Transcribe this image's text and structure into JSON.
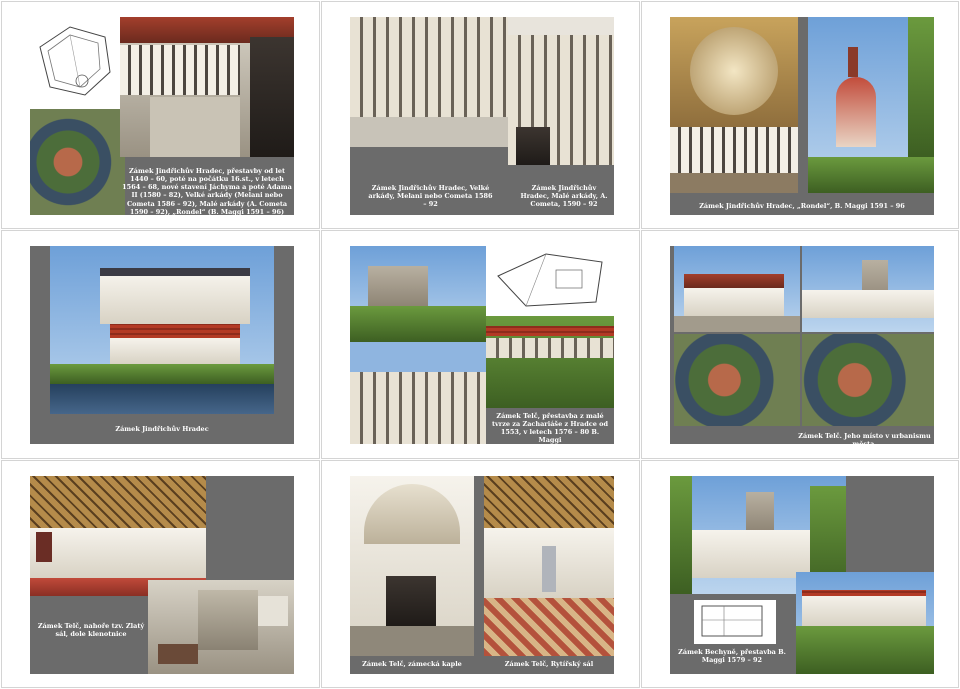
{
  "slides": [
    {
      "id": "slide-1",
      "caption": "Zámek Jindřichův Hradec, přestavby od let 1440 – 60, poté na počátku 16.st., v letech 1564 – 68, nové stavení Jáchyma a poté Adama II (1580 – 82), Velké arkády (Melani nebo Cometa 1586 – 92), Malé arkády (A. Cometa 1590 – 92), „Rondel“ (B. Maggi 1591 – 96)"
    },
    {
      "id": "slide-2",
      "caption_a": "Zámek Jindřichův Hradec, Velké arkády, Melani nebo Cometa 1586 – 92",
      "caption_b": "Zámek Jindřichův Hradec, Malé arkády, A. Cometa, 1590 – 92"
    },
    {
      "id": "slide-3",
      "caption": "Zámek Jindřichův Hradec, „Rondel“, B. Maggi 1591 – 96"
    },
    {
      "id": "slide-4",
      "caption": "Zámek Jindřichův Hradec"
    },
    {
      "id": "slide-5",
      "caption": "Zámek Telč, přestavba z malé tvrze za Zachariáše z Hradce od 1553, v letech 1576 – 80 B. Maggi"
    },
    {
      "id": "slide-6",
      "caption": "Zámek Telč. Jeho místo v urbanismu města."
    },
    {
      "id": "slide-7",
      "caption": "Zámek Telč, nahoře tzv. Zlatý sál, dole klenotnice"
    },
    {
      "id": "slide-8",
      "caption_a": "Zámek Telč, zámecká kaple",
      "caption_b": "Zámek Telč, Rytířský sál"
    },
    {
      "id": "slide-9",
      "caption": "Zámek Bechyně, přestavba B. Maggi 1579 – 92"
    }
  ]
}
